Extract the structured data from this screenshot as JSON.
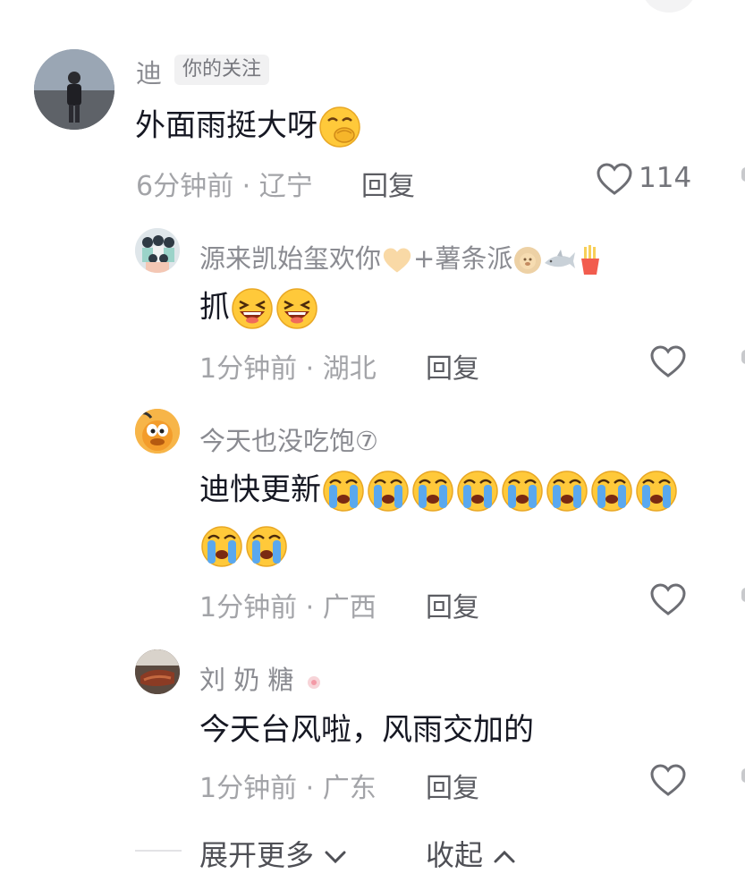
{
  "comments": [
    {
      "username": "迪",
      "badge": "你的关注",
      "text": "外面雨挺大呀",
      "emoji": [
        "covering-mouth-emoji"
      ],
      "time": "6分钟前",
      "location": "· 辽宁",
      "reply_label": "回复",
      "like_count": "114"
    }
  ],
  "replies": [
    {
      "username": "源来凯始玺欢你",
      "username_suffix": "+薯条派",
      "name_emoji": [
        "yellow-heart-icon",
        "lion-icon",
        "shark-icon",
        "fries-icon"
      ],
      "text": "抓",
      "emoji": [
        "laughing-emoji",
        "laughing-emoji"
      ],
      "time": "1分钟前",
      "location": "· 湖北",
      "reply_label": "回复"
    },
    {
      "username": "今天也没吃饱⑦",
      "text": "迪快更新",
      "emoji_count": 10,
      "time": "1分钟前",
      "location": "· 广西",
      "reply_label": "回复"
    },
    {
      "username": "刘 奶 糖",
      "text": "今天台风啦，风雨交加的",
      "time": "1分钟前",
      "location": "· 广东",
      "reply_label": "回复"
    }
  ],
  "footer": {
    "expand_label": "展开更多",
    "collapse_label": "收起"
  },
  "colors": {
    "text": "#161823",
    "muted": "#a3a4a8",
    "reply": "#5b5c62",
    "emoji_yellow": "#ffc93a",
    "emoji_blue": "#5aa8ee"
  }
}
